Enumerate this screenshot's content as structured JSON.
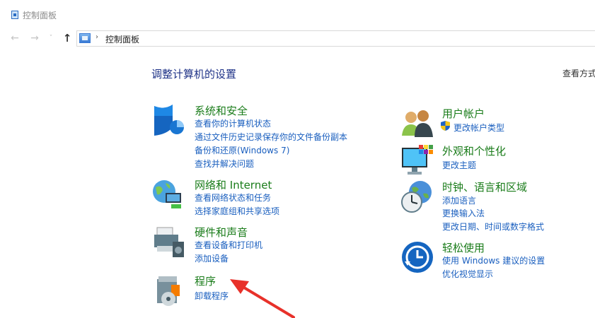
{
  "window": {
    "title": "控制面板"
  },
  "nav": {
    "back": "←",
    "forward": "→",
    "recent": "˅",
    "up": "↑"
  },
  "address": {
    "separator": "›",
    "path": "控制面板"
  },
  "main": {
    "heading": "调整计算机的设置",
    "view_by": "查看方式"
  },
  "left": [
    {
      "title": "系统和安全",
      "icon": "shield-icon",
      "links": [
        "查看你的计算机状态",
        "通过文件历史记录保存你的文件备份副本",
        "备份和还原(Windows 7)",
        "查找并解决问题"
      ]
    },
    {
      "title": "网络和 Internet",
      "icon": "network-globe-icon",
      "links": [
        "查看网络状态和任务",
        "选择家庭组和共享选项"
      ]
    },
    {
      "title": "硬件和声音",
      "icon": "printer-speaker-icon",
      "links": [
        "查看设备和打印机",
        "添加设备"
      ]
    },
    {
      "title": "程序",
      "icon": "programs-disc-icon",
      "links": [
        "卸载程序"
      ]
    }
  ],
  "right": [
    {
      "title": "用户帐户",
      "icon": "users-icon",
      "links": [
        "更改帐户类型"
      ]
    },
    {
      "title": "外观和个性化",
      "icon": "monitor-palette-icon",
      "links": [
        "更改主题"
      ]
    },
    {
      "title": "时钟、语言和区域",
      "icon": "clock-globe-icon",
      "links": [
        "添加语言",
        "更换输入法",
        "更改日期、时间或数字格式"
      ]
    },
    {
      "title": "轻松使用",
      "icon": "ease-of-access-icon",
      "links": [
        "使用 Windows 建议的设置",
        "优化视觉显示"
      ]
    }
  ],
  "colors": {
    "heading": "#1e3287",
    "category": "#1a7c1a",
    "link": "#1a5fbf",
    "arrow": "#e8312a"
  }
}
